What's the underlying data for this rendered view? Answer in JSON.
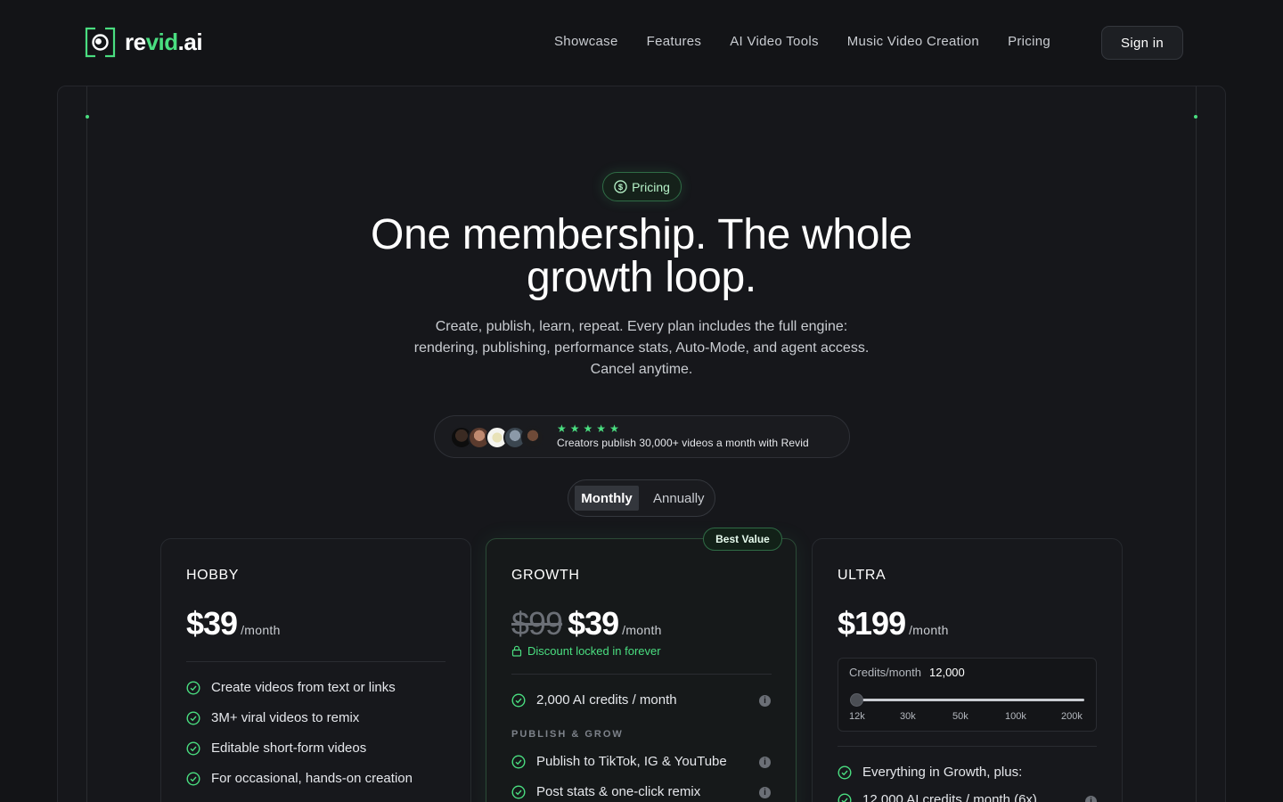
{
  "nav": {
    "brand_part1": "re",
    "brand_part2": "vid",
    "brand_part3": ".ai",
    "links": [
      "Showcase",
      "Features",
      "AI Video Tools",
      "Music Video Creation",
      "Pricing"
    ],
    "signin_label": "Sign in"
  },
  "hero": {
    "badge_label": "Pricing",
    "title_line1": "One membership. The whole",
    "title_line2": "growth loop.",
    "subtitle_line1": "Create, publish, learn, repeat. Every plan includes the full engine:",
    "subtitle_line2": "rendering, publishing, performance stats, Auto-Mode, and agent access.",
    "subtitle_line3": "Cancel anytime.",
    "social_text": "Creators publish 30,000+ videos a month with Revid",
    "rating_stars": 5
  },
  "billing_toggle": {
    "monthly_label": "Monthly",
    "annually_label": "Annually",
    "selected": "Monthly"
  },
  "plans": {
    "hobby": {
      "name": "HOBBY",
      "price": "$39",
      "period": "/month",
      "features": [
        "Create videos from text or links",
        "3M+ viral videos to remix",
        "Editable short-form videos",
        "For occasional, hands-on creation"
      ]
    },
    "growth": {
      "badge": "Best Value",
      "name": "GROWTH",
      "old_price": "$99",
      "price": "$39",
      "period": "/month",
      "discount_note": "Discount locked in forever",
      "credits_feature": "2,000 AI credits / month",
      "section_label": "PUBLISH & GROW",
      "features": [
        "Publish to TikTok, IG & YouTube",
        "Post stats & one-click remix"
      ]
    },
    "ultra": {
      "name": "ULTRA",
      "price": "$199",
      "period": "/month",
      "credits_label": "Credits/month",
      "credits_value": "12,000",
      "credit_ticks": [
        "12k",
        "30k",
        "50k",
        "100k",
        "200k"
      ],
      "slider_position": 0,
      "feature_intro": "Everything in Growth, plus:",
      "features_partial": [
        "12,000 AI credits / month (6x)"
      ]
    }
  },
  "colors": {
    "accent": "#4ade80",
    "background": "#131417"
  }
}
